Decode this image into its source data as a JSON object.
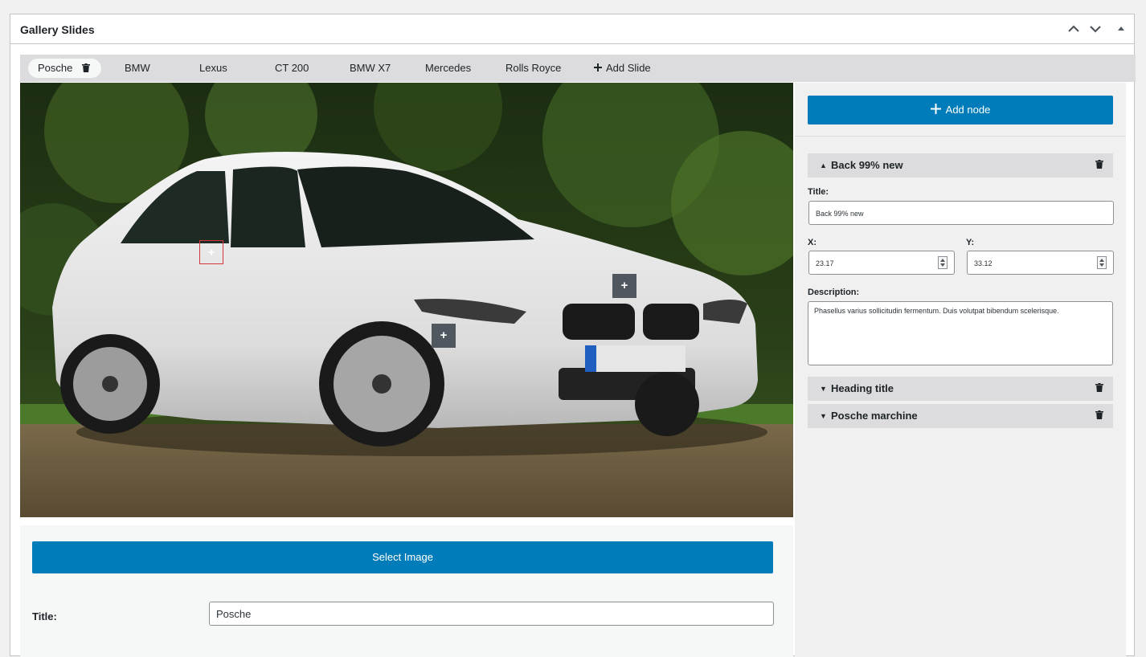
{
  "panel": {
    "title": "Gallery Slides"
  },
  "tabs": [
    {
      "label": "Posche",
      "active": true
    },
    {
      "label": "BMW"
    },
    {
      "label": "Lexus"
    },
    {
      "label": "CT 200"
    },
    {
      "label": "BMW X7"
    },
    {
      "label": "Mercedes"
    },
    {
      "label": "Rolls Royce"
    }
  ],
  "add_slide_label": "Add Slide",
  "image": {
    "hotspot_symbol": "+"
  },
  "left_form": {
    "select_image_label": "Select Image",
    "title_label": "Title:",
    "title_value": "Posche"
  },
  "right": {
    "add_node_label": "Add node",
    "nodes": [
      {
        "label": "Back 99% new",
        "expanded": true
      },
      {
        "label": "Heading title",
        "expanded": false
      },
      {
        "label": "Posche marchine",
        "expanded": false
      }
    ],
    "active_node": {
      "title_label": "Title:",
      "title_value": "Back 99% new",
      "x_label": "X:",
      "x_value": "23.17",
      "y_label": "Y:",
      "y_value": "33.12",
      "description_label": "Description:",
      "description_value": "Phasellus varius sollicitudin fermentum. Duis volutpat bibendum scelerisque."
    }
  },
  "colors": {
    "primary": "#007cba",
    "tab_bar": "#dcdcde",
    "active_hotspot_border": "#d63638",
    "hotspot_bg": "#50575e"
  }
}
